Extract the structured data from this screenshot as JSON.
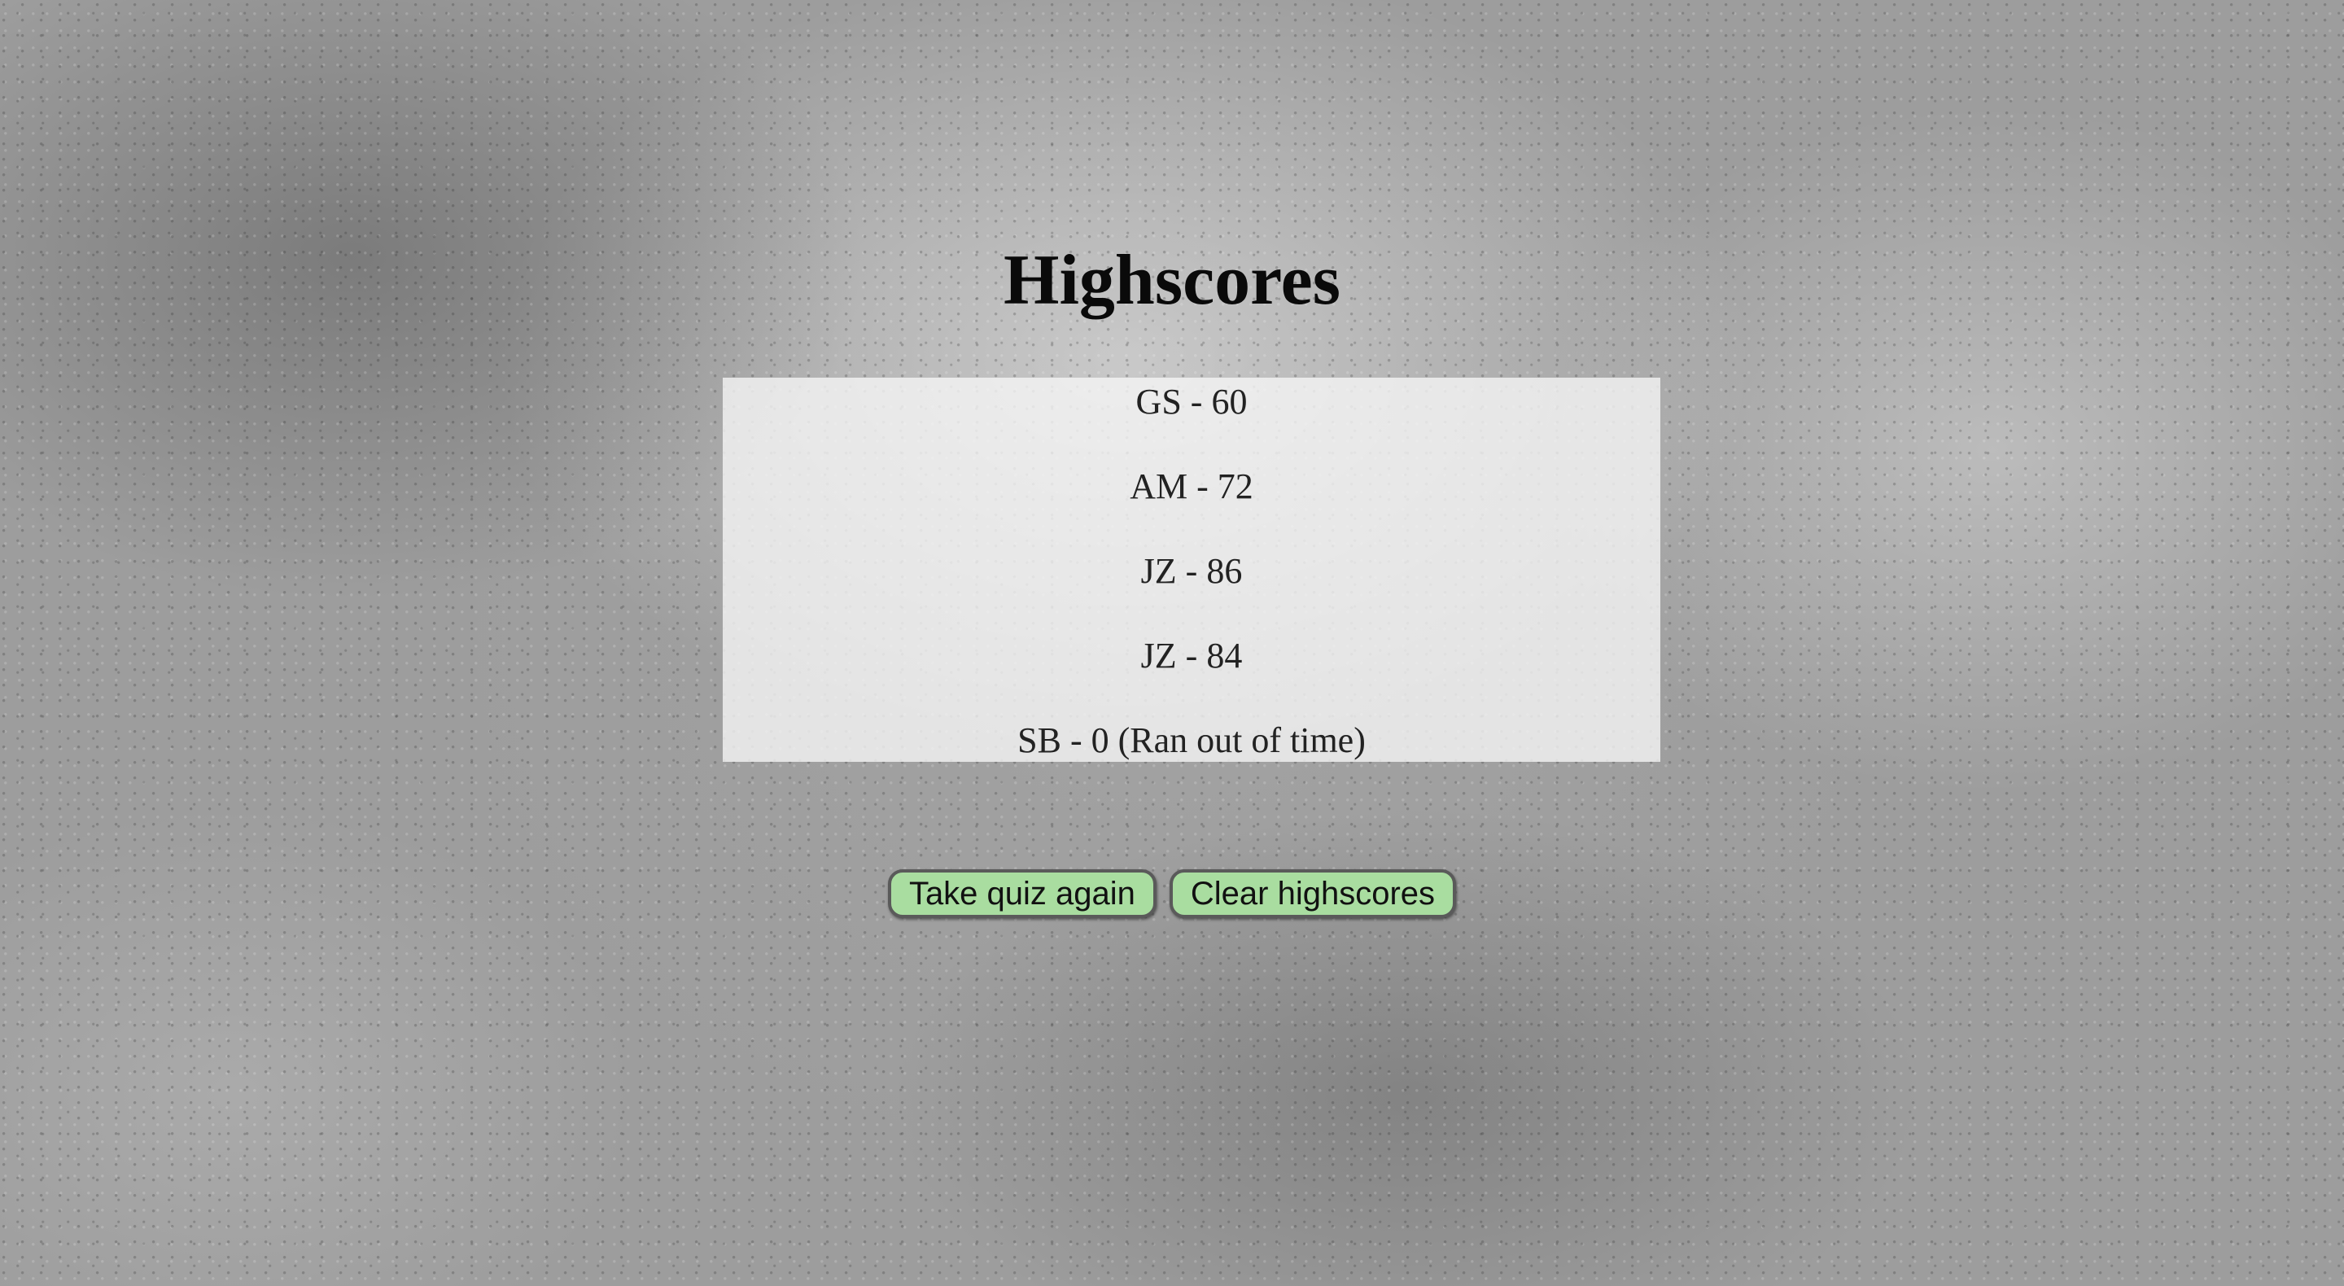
{
  "page": {
    "title": "Highscores"
  },
  "scores": [
    {
      "label": "GS - 60"
    },
    {
      "label": "AM - 72"
    },
    {
      "label": "JZ - 86"
    },
    {
      "label": "JZ - 84"
    },
    {
      "label": "SB - 0 (Ran out of time)"
    }
  ],
  "actions": {
    "retake_label": "Take quiz again",
    "clear_label": "Clear highscores"
  },
  "colors": {
    "button_bg": "#a9dda0",
    "panel_bg": "#f5f5f5"
  }
}
